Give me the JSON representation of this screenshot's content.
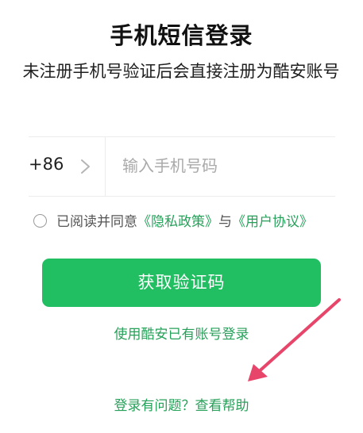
{
  "title": "手机短信登录",
  "subtitle": "未注册手机号验证后会直接注册为酷安账号",
  "phone": {
    "country_code": "+86",
    "placeholder": "输入手机号码",
    "value": ""
  },
  "agreement": {
    "prefix": "已阅读并同意",
    "privacy_link": "《隐私政策》",
    "conjunction": "与",
    "terms_link": "《用户协议》"
  },
  "actions": {
    "get_code": "获取验证码",
    "use_account": "使用酷安已有账号登录",
    "help": "登录有问题？查看帮助"
  },
  "colors": {
    "accent": "#21bf62",
    "link": "#26a15a",
    "annotation_arrow": "#e8456a"
  },
  "icons": {
    "country_selector": "chevron-right-icon",
    "agreement_checkbox": "radio-unchecked-icon",
    "annotation": "arrow-annotation"
  }
}
